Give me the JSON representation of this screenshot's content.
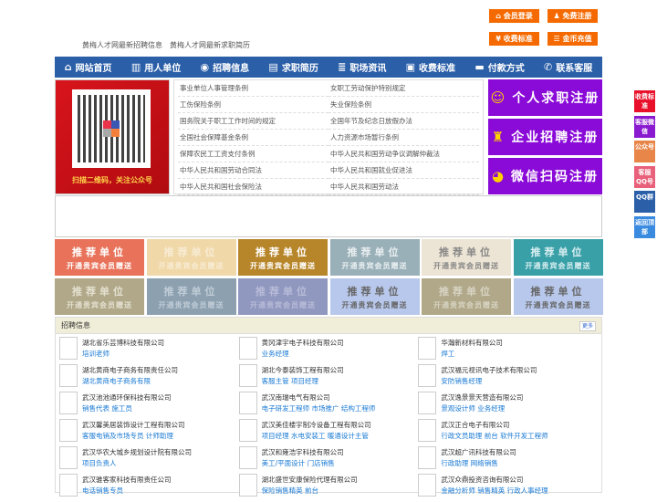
{
  "top_buttons": [
    {
      "label": "会员登录",
      "icon": "home-icon"
    },
    {
      "label": "免费注册",
      "icon": "user-add-icon"
    },
    {
      "label": "收费标准",
      "icon": "yen-icon"
    },
    {
      "label": "金币充值",
      "icon": "coins-icon"
    }
  ],
  "top_links": [
    "黄梅人才网最新招聘信息",
    "黄梅人才网最新求职简历"
  ],
  "nav": [
    {
      "label": "网站首页",
      "icon": "home-icon"
    },
    {
      "label": "用人单位",
      "icon": "building-icon"
    },
    {
      "label": "招聘信息",
      "icon": "chat-icon"
    },
    {
      "label": "求职简历",
      "icon": "document-icon"
    },
    {
      "label": "职场资讯",
      "icon": "list-icon"
    },
    {
      "label": "收费标准",
      "icon": "money-bag-icon"
    },
    {
      "label": "付款方式",
      "icon": "card-icon"
    },
    {
      "label": "联系客服",
      "icon": "phone-icon"
    }
  ],
  "qr": {
    "caption": "扫描二维码，关注公众号"
  },
  "law_links": [
    "事业单位人事管理条例",
    "女职工劳动保护特别规定",
    "工伤保险条例",
    "失业保险条例",
    "国务院关于职工工作时间的规定",
    "全国年节及纪念日放假办法",
    "全国社会保障基金条例",
    "人力资源市场暂行条例",
    "保障农民工工资支付条例",
    "中华人民共和国劳动争议调解仲裁法",
    "中华人民共和国劳动合同法",
    "中华人民共和国就业促进法",
    "中华人民共和国社会保险法",
    "中华人民共和国劳动法"
  ],
  "register": [
    {
      "label": "个人求职注册",
      "icon": "person-icon"
    },
    {
      "label": "企业招聘注册",
      "icon": "company-icon"
    },
    {
      "label": "微信扫码注册",
      "icon": "wechat-icon"
    }
  ],
  "tiles": {
    "title": "推荐单位",
    "subtitle": "开通贵宾会员赠送",
    "colors": [
      [
        "#e8735a",
        "#fff"
      ],
      [
        "#f0d8a8",
        "#f8ecd4"
      ],
      [
        "#b8862a",
        "#fff"
      ],
      [
        "#9ab0b8",
        "#e8eef0"
      ],
      [
        "#ece4d4",
        "#888"
      ],
      [
        "#3aa0a8",
        "#d8eef0"
      ],
      [
        "#b0a888",
        "#e4e0d0"
      ],
      [
        "#8ca0b0",
        "#c0ccd6"
      ],
      [
        "#9098c0",
        "#b8bcd8"
      ],
      [
        "#b8c8ec",
        "#666"
      ],
      [
        "#b0a888",
        "#d8d4c4"
      ],
      [
        "#b8c8ec",
        "#666"
      ]
    ]
  },
  "jobs_section": {
    "title": "招聘信息",
    "more": "更多",
    "items": [
      {
        "company": "湖北省乐芸博科技有限公司",
        "jobs": "培训老师"
      },
      {
        "company": "黄冈津宇电子科技有限公司",
        "jobs": "业务经理"
      },
      {
        "company": "华瀚新材料有限公司",
        "jobs": "焊工"
      },
      {
        "company": "湖北黄商电子商务有限责任公司",
        "jobs": "湖北黄商电子商务有限"
      },
      {
        "company": "湖北今泰装饰工程有限公司",
        "jobs": "客服主管 项目经理"
      },
      {
        "company": "武汉福元视讯电子技术有限公司",
        "jobs": "安防销售经理"
      },
      {
        "company": "武汉池池通环保科技有限公司",
        "jobs": "销售代表 施工员"
      },
      {
        "company": "武汉南瑞电气有限公司",
        "jobs": "电子研发工程师 市场推广 结构工程师"
      },
      {
        "company": "武汉逸景景天营造有限公司",
        "jobs": "景观设计师 业务经理"
      },
      {
        "company": "武汉馨美居装饰设计工程有限公司",
        "jobs": "客服电销及市场专员 计师助理"
      },
      {
        "company": "武汉美佳楼宇制冷设备工程有限公司",
        "jobs": "项目经理 水电安装工 暖通设计主管"
      },
      {
        "company": "武汉正合电子有限公司",
        "jobs": "行政文员助理 前台 软件开发工程师"
      },
      {
        "company": "武汉华农大城乡规划设计院有限公司",
        "jobs": "项目负责人"
      },
      {
        "company": "武汉和雍浩宇科技有限公司",
        "jobs": "美工/平面设计 门店销售"
      },
      {
        "company": "武汉超广讯科技有限公司",
        "jobs": "行政助理 网络销售"
      },
      {
        "company": "武汉骓客家科技有限责任公司",
        "jobs": "电话销售专员"
      },
      {
        "company": "湖北盛世安康保险代理有限公司",
        "jobs": "保险销售精英 前台"
      },
      {
        "company": "武汉众鼎投资咨询有限公司",
        "jobs": "金融分析师 销售精英 行政人事经理"
      }
    ]
  },
  "sidebar": [
    {
      "label": "收费标准",
      "color": "#e8102a"
    },
    {
      "label": "客服微信",
      "color": "#8a1ad0"
    },
    {
      "label": "公众号",
      "color": "#e8864a"
    },
    {
      "label": "客服QQ号",
      "color": "#e8607a"
    },
    {
      "label": "QQ群",
      "color": "#2b5fa8"
    },
    {
      "label": "返回顶部",
      "color": "#3a8ae0"
    }
  ]
}
